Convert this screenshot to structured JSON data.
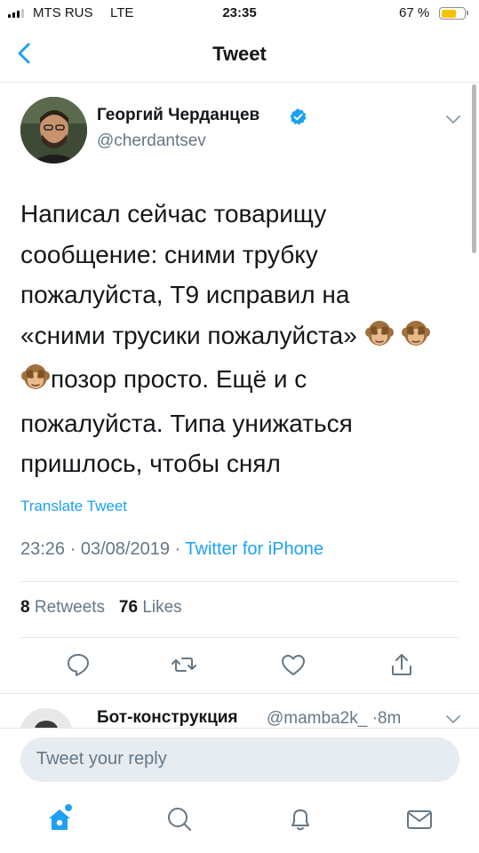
{
  "status_bar": {
    "carrier": "MTS RUS",
    "network": "LTE",
    "time": "23:35",
    "battery_percent": "67 %",
    "battery_level": 0.67
  },
  "nav": {
    "title": "Tweet",
    "back_icon": "chevron-left-icon"
  },
  "tweet": {
    "author_name": "Георгий Черданцев",
    "handle": "@cherdantsev",
    "verified": true,
    "text_lines": [
      "Написал сейчас товарищу",
      "сообщение: сними трубку",
      "пожалуйста, Т9 исправил на",
      "«сними трусики пожалуйста»",
      "позор просто. Ещё и с",
      "пожалуйста. Типа унижаться",
      "пришлось, чтобы снял"
    ],
    "emoji": "see-no-evil-monkey",
    "translate_label": "Translate Tweet",
    "time": "23:26",
    "date": "03/08/2019",
    "separator": "·",
    "source": "Twitter for iPhone",
    "retweets_count": "8",
    "retweets_label": "Retweets",
    "likes_count": "76",
    "likes_label": "Likes"
  },
  "actions": {
    "reply_icon": "reply-icon",
    "retweet_icon": "retweet-icon",
    "like_icon": "heart-icon",
    "share_icon": "share-icon"
  },
  "reply_preview": {
    "name": "Бот-конструкция",
    "handle": "@mamba2k_",
    "time": "8m"
  },
  "composer": {
    "placeholder": "Tweet your reply"
  },
  "tabbar": {
    "items": [
      "home-icon",
      "search-icon",
      "notifications-icon",
      "messages-icon"
    ],
    "active": "home-icon"
  },
  "colors": {
    "accent": "#1da1f2",
    "secondary_text": "#657786",
    "divider": "#e1e8ed",
    "battery": "#f5c400"
  }
}
